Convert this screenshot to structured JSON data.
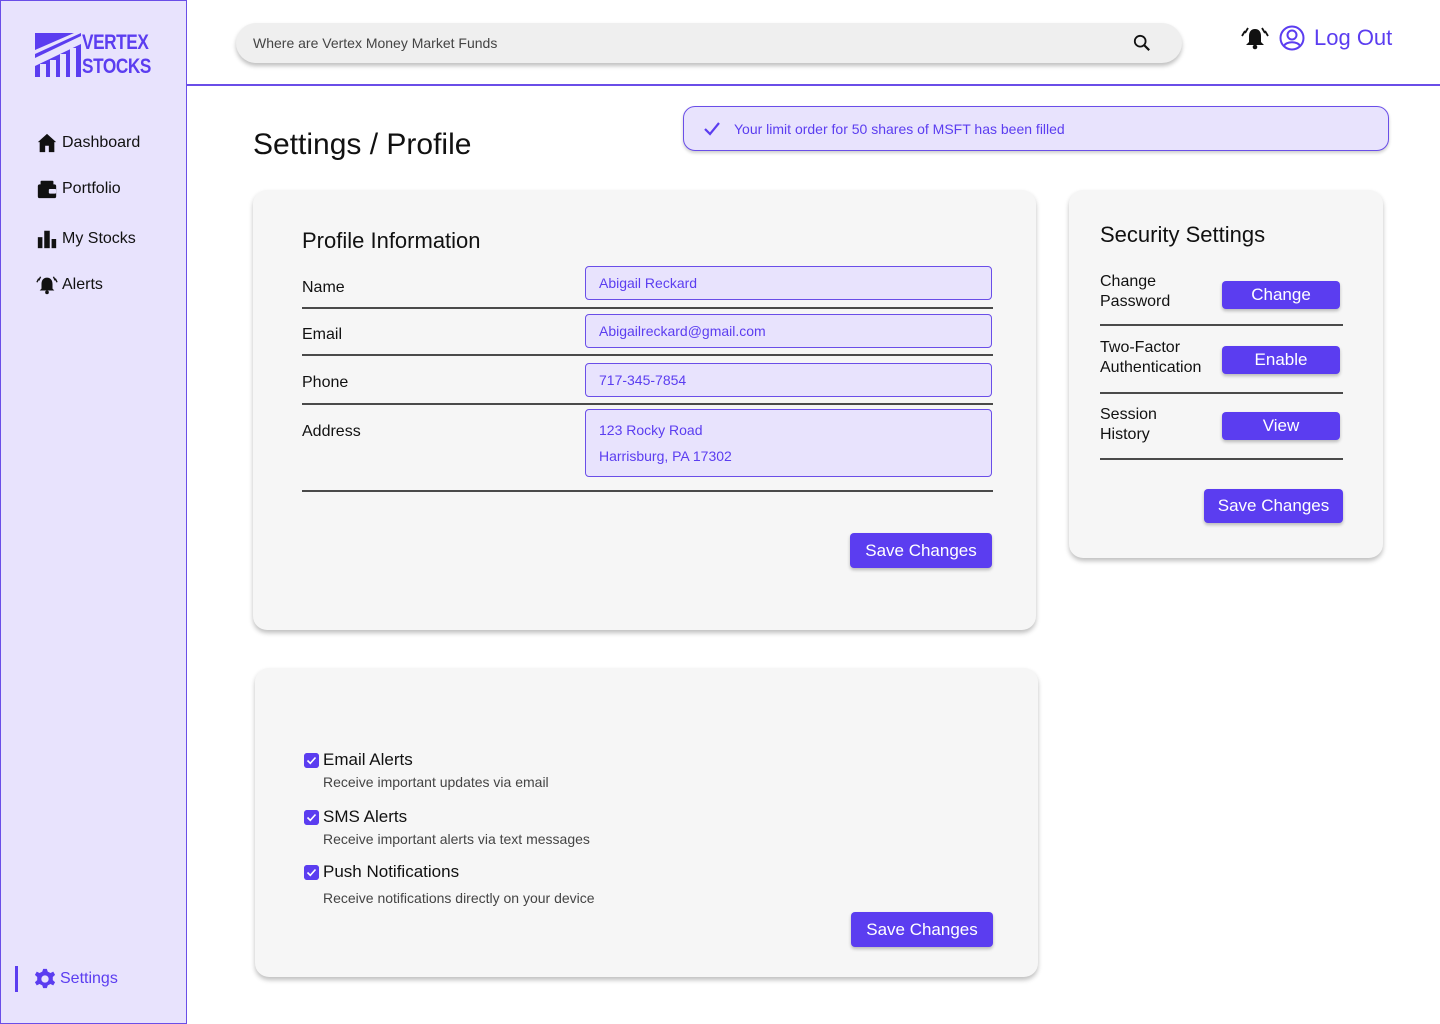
{
  "brand": {
    "line1": "VERTEX",
    "line2": "STOCKS",
    "accent": "#5b3df0"
  },
  "sidebar": {
    "items": [
      {
        "label": "Dashboard",
        "icon": "home-icon"
      },
      {
        "label": "Portfolio",
        "icon": "wallet-icon"
      },
      {
        "label": "My Stocks",
        "icon": "bar-chart-icon"
      },
      {
        "label": "Alerts",
        "icon": "bell-icon"
      }
    ],
    "settings": {
      "label": "Settings",
      "icon": "gear-icon"
    }
  },
  "header": {
    "search_placeholder": "Where are Vertex Money Market Funds",
    "logout_label": "Log Out"
  },
  "page": {
    "title": "Settings / Profile"
  },
  "toast": {
    "message": "Your limit order for 50 shares of MSFT has been filled"
  },
  "profile": {
    "heading": "Profile Information",
    "fields": [
      {
        "label": "Name",
        "value": "Abigail Reckard"
      },
      {
        "label": "Email",
        "value": "Abigailreckard@gmail.com"
      },
      {
        "label": "Phone",
        "value": "717-345-7854"
      },
      {
        "label": "Address",
        "value_line1": "123 Rocky Road",
        "value_line2": "Harrisburg, PA 17302"
      }
    ],
    "save_label": "Save Changes"
  },
  "security": {
    "heading": "Security Settings",
    "rows": [
      {
        "label_line1": "Change",
        "label_line2": "Password",
        "button": "Change"
      },
      {
        "label_line1": "Two-Factor",
        "label_line2": "Authentication",
        "button": "Enable"
      },
      {
        "label_line1": "Session",
        "label_line2": "History",
        "button": "View"
      }
    ],
    "save_label": "Save Changes"
  },
  "alerts": {
    "items": [
      {
        "title": "Email Alerts",
        "desc": "Receive important updates via email",
        "checked": true
      },
      {
        "title": "SMS Alerts",
        "desc": "Receive important alerts via text messages",
        "checked": true
      },
      {
        "title": "Push Notifications",
        "desc": "Receive notifications directly on your device",
        "checked": true
      }
    ],
    "save_label": "Save Changes"
  }
}
